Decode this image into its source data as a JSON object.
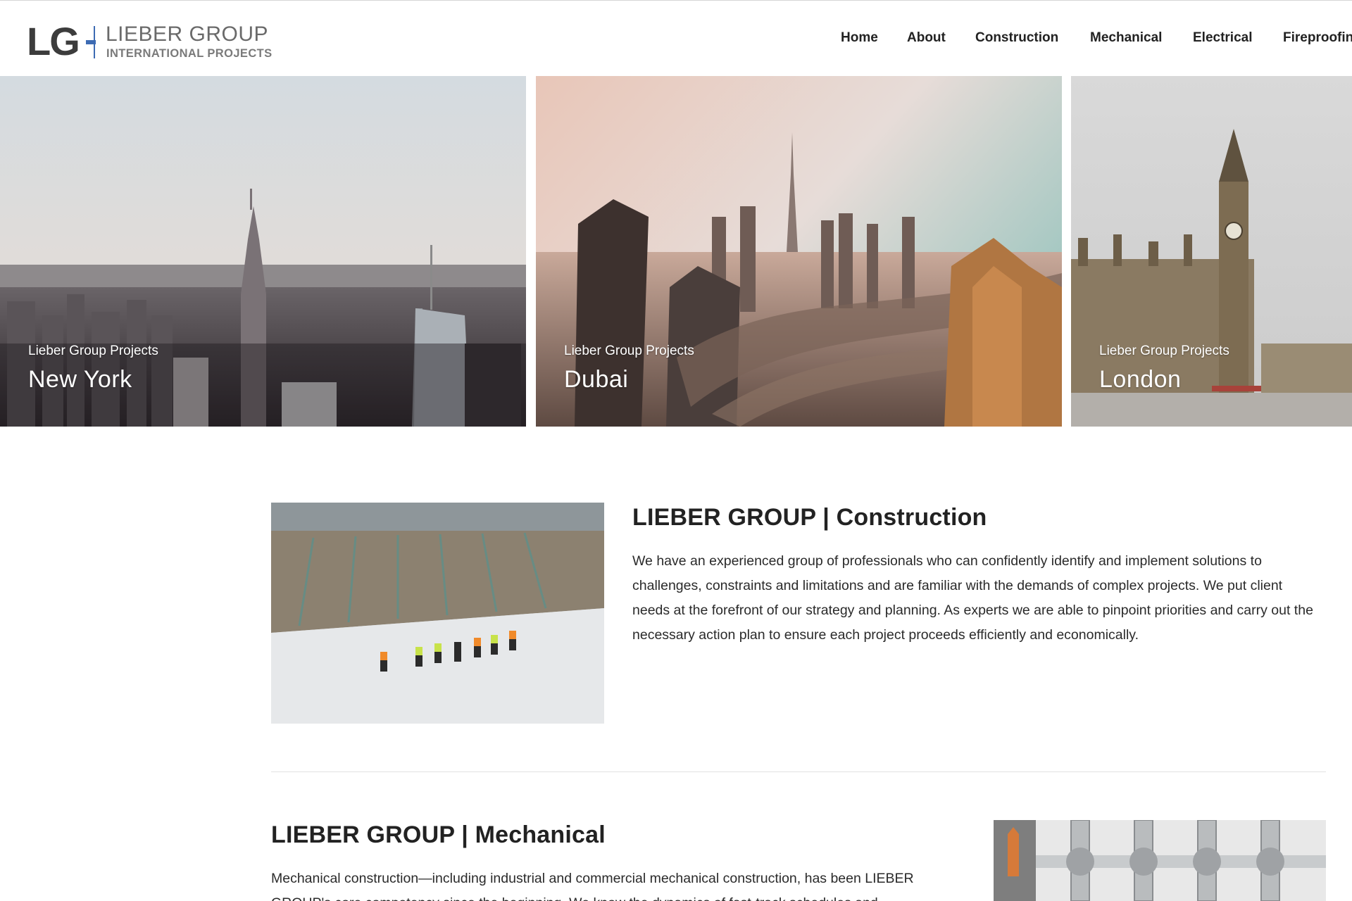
{
  "header": {
    "logo_mark": "LG",
    "logo_name": "LIEBER GROUP",
    "logo_tagline": "INTERNATIONAL PROJECTS",
    "brand_color": "#3d6bb3"
  },
  "nav": {
    "items": [
      "Home",
      "About",
      "Construction",
      "Mechanical",
      "Electrical",
      "Fireproofing"
    ]
  },
  "slider": {
    "slides": [
      {
        "subtitle": "Lieber Group Projects",
        "city": "New York"
      },
      {
        "subtitle": "Lieber Group Projects",
        "city": "Dubai"
      },
      {
        "subtitle": "Lieber Group Projects",
        "city": "London"
      }
    ]
  },
  "sections": {
    "construction": {
      "title": "LIEBER GROUP | Construction",
      "text": "We have an experienced group of professionals who can confidently identify and implement solutions to challenges, constraints and limitations and are familiar with the demands of complex projects. We put client needs at the forefront of our strategy and planning. As experts we are able to pinpoint priorities and carry out the necessary action plan to ensure each project proceeds efficiently and economically."
    },
    "mechanical": {
      "title": "LIEBER GROUP | Mechanical",
      "text": "Mechanical construction—including industrial and commercial mechanical construction, has been LIEBER GROUP's core competency since the beginning. We know the dynamics of fast-track schedules and"
    }
  }
}
